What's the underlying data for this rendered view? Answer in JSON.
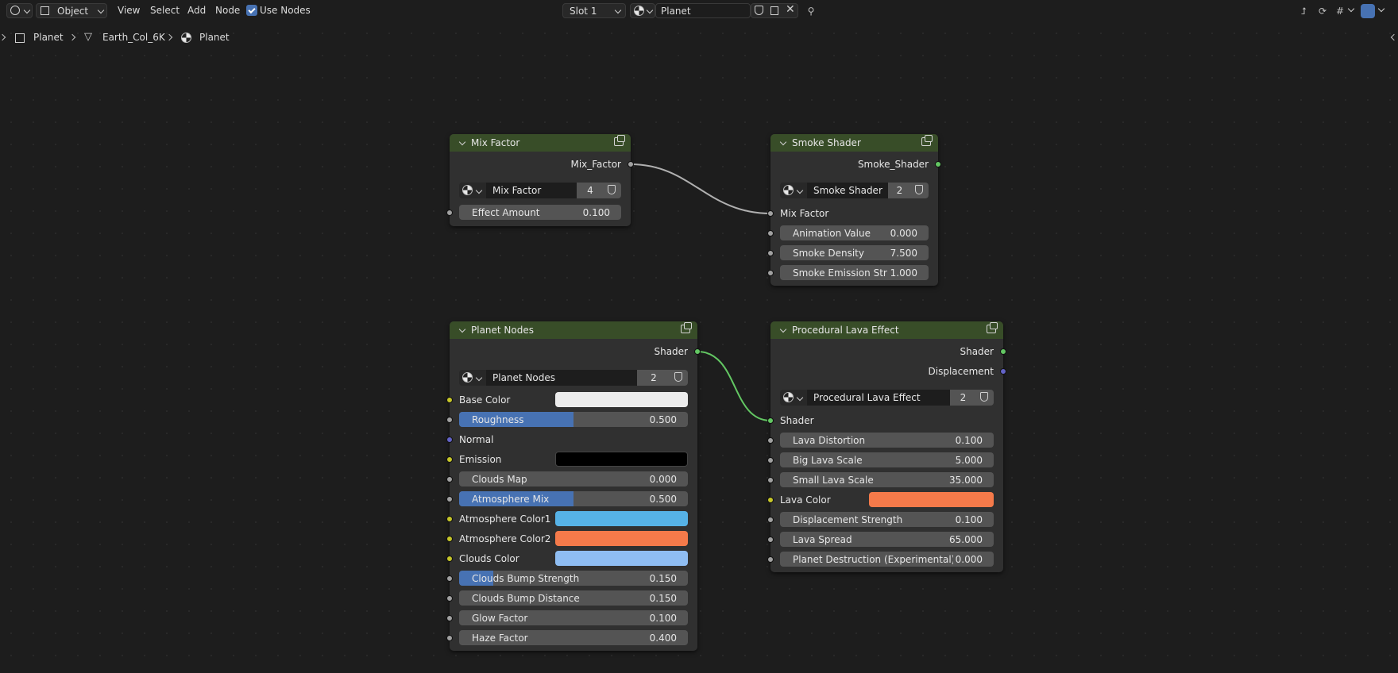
{
  "header": {
    "mode_label": "Object",
    "menu": [
      "View",
      "Select",
      "Add",
      "Node"
    ],
    "use_nodes_label": "Use Nodes",
    "use_nodes_checked": true,
    "slot_label": "Slot 1",
    "material_name": "Planet"
  },
  "breadcrumb": {
    "items": [
      "Planet",
      "Earth_Col_6K",
      "Planet"
    ]
  },
  "nodes": {
    "mix_factor": {
      "title": "Mix Factor",
      "output": "Mix_Factor",
      "group_name": "Mix Factor",
      "group_users": "4",
      "inputs": [
        {
          "label": "Effect Amount",
          "value": "0.100"
        }
      ]
    },
    "smoke_shader": {
      "title": "Smoke Shader",
      "output": "Smoke_Shader",
      "group_name": "Smoke Shader",
      "group_users": "2",
      "link_input": "Mix Factor",
      "inputs": [
        {
          "label": "Animation Value",
          "value": "0.000"
        },
        {
          "label": "Smoke Density",
          "value": "7.500"
        },
        {
          "label": "Smoke Emission Str",
          "value": "1.000"
        }
      ]
    },
    "planet_nodes": {
      "title": "Planet Nodes",
      "output": "Shader",
      "group_name": "Planet Nodes",
      "group_users": "2",
      "base_color": {
        "label": "Base Color",
        "color": "#ececec"
      },
      "roughness": {
        "label": "Roughness",
        "value": "0.500",
        "fraction": 0.5
      },
      "normal": {
        "label": "Normal"
      },
      "emission": {
        "label": "Emission",
        "color": "#000000"
      },
      "clouds_map": {
        "label": "Clouds Map",
        "value": "0.000"
      },
      "atmosphere_mix": {
        "label": "Atmosphere Mix",
        "value": "0.500",
        "fraction": 0.5
      },
      "atmosphere_color1": {
        "label": "Atmosphere Color1",
        "color": "#56b2e6"
      },
      "atmosphere_color2": {
        "label": "Atmosphere Color2",
        "color": "#f57a4a"
      },
      "clouds_color": {
        "label": "Clouds Color",
        "color": "#8fbdf2"
      },
      "clouds_bump_strength": {
        "label": "Clouds Bump Strength",
        "value": "0.150",
        "fraction": 0.15
      },
      "clouds_bump_distance": {
        "label": "Clouds Bump Distance",
        "value": "0.150"
      },
      "glow_factor": {
        "label": "Glow Factor",
        "value": "0.100"
      },
      "haze_factor": {
        "label": "Haze Factor",
        "value": "0.400"
      }
    },
    "procedural_lava": {
      "title": "Procedural Lava Effect",
      "output_shader": "Shader",
      "output_displacement": "Displacement",
      "group_name": "Procedural Lava Effect",
      "group_users": "2",
      "link_input": "Shader",
      "lava_distortion": {
        "label": "Lava Distortion",
        "value": "0.100"
      },
      "big_lava_scale": {
        "label": "Big Lava Scale",
        "value": "5.000"
      },
      "small_lava_scale": {
        "label": "Small Lava Scale",
        "value": "35.000"
      },
      "lava_color": {
        "label": "Lava Color",
        "color": "#f57a4a"
      },
      "displacement_strength": {
        "label": "Displacement Strength",
        "value": "0.100"
      },
      "lava_spread": {
        "label": "Lava Spread",
        "value": "65.000"
      },
      "planet_destruction": {
        "label": "Planet Destruction (Experimental)",
        "value": "0.000"
      }
    }
  },
  "colors": {
    "node_header": "#384d28",
    "field_fill": "#4772b3",
    "socket_gray": "#a1a1a1",
    "socket_green": "#63c763",
    "socket_yellow": "#c7c729",
    "socket_purple": "#6363c7"
  }
}
